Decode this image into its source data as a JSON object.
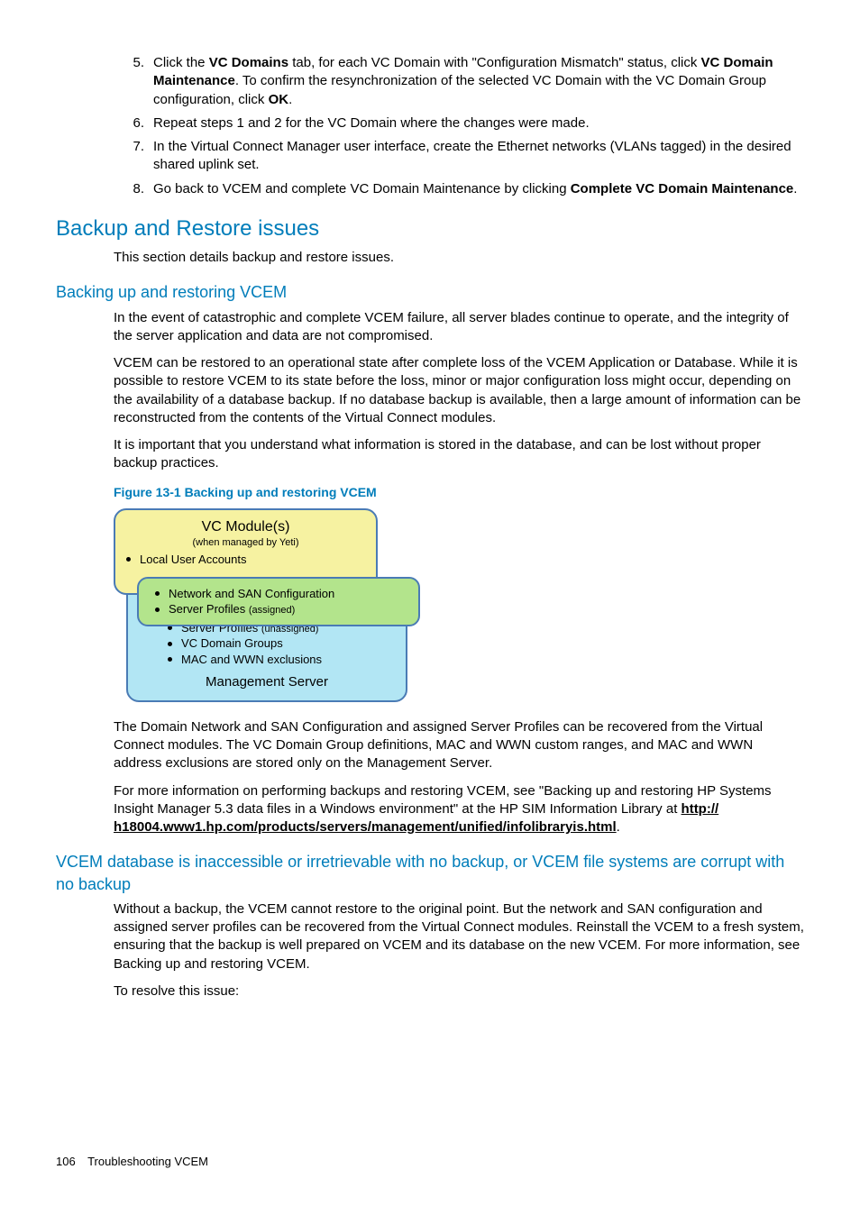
{
  "list": {
    "item5": {
      "num": "5.",
      "pre": "Click the ",
      "b1": "VC Domains",
      "mid1": " tab, for each VC Domain with \"Configuration Mismatch\" status, click ",
      "b2": "VC Domain Maintenance",
      "mid2": ". To confirm the resynchronization of the selected VC Domain with the VC Domain Group configuration, click ",
      "b3": "OK",
      "post": "."
    },
    "item6": {
      "num": "6.",
      "text": "Repeat steps 1 and 2 for the VC Domain where the changes were made."
    },
    "item7": {
      "num": "7.",
      "text": "In the Virtual Connect Manager user interface, create the Ethernet networks (VLANs tagged) in the desired shared uplink set."
    },
    "item8": {
      "num": "8.",
      "pre": "Go back to VCEM and complete VC Domain Maintenance by clicking ",
      "b1": "Complete VC Domain Maintenance",
      "post": "."
    }
  },
  "sec1": {
    "title": "Backup and Restore issues",
    "intro": "This section details backup and restore issues."
  },
  "sub1": {
    "title": "Backing up and restoring VCEM",
    "p1": "In the event of catastrophic and complete VCEM failure, all server blades continue to operate, and the integrity of the server application and data are not compromised.",
    "p2": "VCEM can be restored to an operational state after complete loss of the VCEM Application or Database. While it is possible to restore VCEM to its state before the loss, minor or major configuration loss might occur, depending on the availability of a database backup. If no database backup is available, then a large amount of information can be reconstructed from the contents of the Virtual Connect modules.",
    "p3": "It is important that you understand what information is stored in the database, and can be lost without proper backup practices.",
    "figcap": "Figure 13-1 Backing up and restoring VCEM"
  },
  "diagram": {
    "vc_title": "VC Module(s)",
    "vc_sub": "(when managed by Yeti)",
    "lua": "Local User Accounts",
    "g1": "Network and SAN Configuration",
    "g2a": "Server Profiles ",
    "g2b": "(assigned)",
    "b1a": "Server Profiles ",
    "b1b": "(unassigned)",
    "b2": "VC Domain Groups",
    "b3": "MAC and WWN exclusions",
    "mgmt": "Management Server"
  },
  "after": {
    "p1": "The Domain Network and SAN Configuration and assigned Server Profiles can be recovered from the Virtual Connect modules. The VC Domain Group definitions, MAC and WWN custom ranges, and MAC and WWN address exclusions are stored only on the Management Server.",
    "p2a": "For more information on performing backups and restoring VCEM, see \"Backing up and restoring HP Systems Insight Manager 5.3 data files in a Windows environment\" at the HP SIM Information Library at ",
    "link1": "http://",
    "link2": "h18004.www1.hp.com/products/servers/management/unified/infolibraryis.html",
    "p2b": "."
  },
  "sub2": {
    "title": "VCEM database is inaccessible or irretrievable with no backup, or VCEM file systems are corrupt with no backup",
    "p1a": "Without a backup, the VCEM cannot restore to the original point. But the network and SAN configuration and assigned server profiles can be recovered from the Virtual Connect modules. Reinstall the VCEM to a fresh system, ensuring that the backup is well prepared on VCEM and its database on the new VCEM. For more information, see ",
    "p1link": "Backing up and restoring VCEM",
    "p1b": ".",
    "p2": "To resolve this issue:"
  },
  "footer": {
    "page": "106",
    "section": "Troubleshooting VCEM"
  }
}
